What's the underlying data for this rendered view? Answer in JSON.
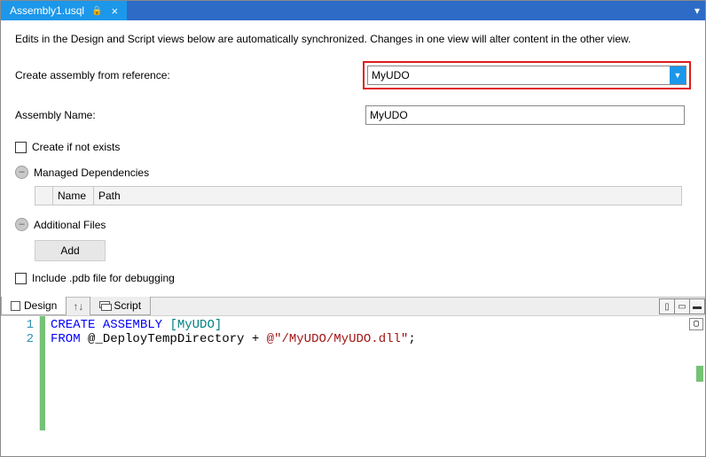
{
  "tab": {
    "title": "Assembly1.usql",
    "close_glyph": "×"
  },
  "info_text": "Edits in the Design and Script views below are automatically synchronized. Changes in one view will alter content in the other view.",
  "form": {
    "reference_label": "Create assembly from reference:",
    "reference_value": "MyUDO",
    "name_label": "Assembly Name:",
    "name_value": "MyUDO",
    "create_if_not_exists_label": "Create if not exists",
    "managed_deps_label": "Managed Dependencies",
    "additional_files_label": "Additional Files",
    "grid_cols": {
      "name": "Name",
      "path": "Path"
    },
    "add_label": "Add",
    "include_pdb_label": "Include .pdb file for debugging"
  },
  "bottom_tabs": {
    "design": "Design",
    "script": "Script"
  },
  "script": {
    "lines": [
      "1",
      "2"
    ],
    "l1_kw1": "CREATE",
    "l1_kw2": "ASSEMBLY",
    "l1_id": "[MyUDO]",
    "l2_kw": "FROM",
    "l2_var": "@_DeployTempDirectory",
    "l2_plus": " + ",
    "l2_str": "@\"/MyUDO/MyUDO.dll\"",
    "l2_semi": ";"
  }
}
